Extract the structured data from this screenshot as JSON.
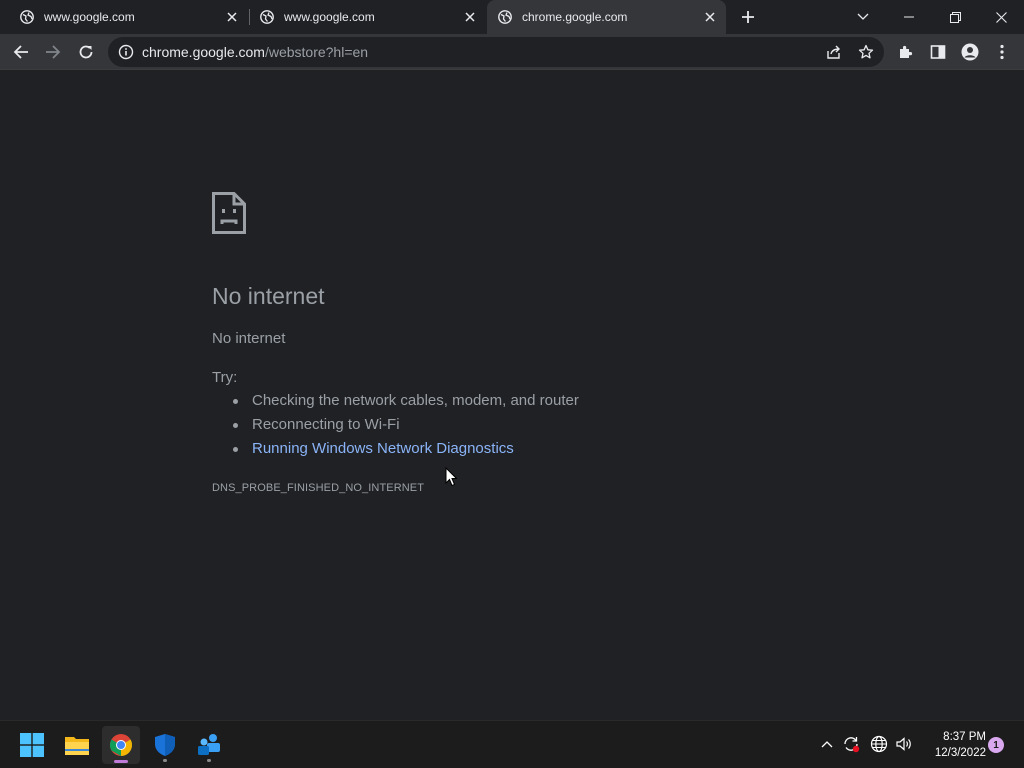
{
  "tabs": [
    {
      "title": "www.google.com",
      "active": false
    },
    {
      "title": "www.google.com",
      "active": false
    },
    {
      "title": "chrome.google.com",
      "active": true
    }
  ],
  "omnibox": {
    "url_host": "chrome.google.com",
    "url_path": "/webstore?hl=en"
  },
  "error_page": {
    "title": "No internet",
    "subtitle": "No internet",
    "try_label": "Try:",
    "suggestions": [
      {
        "text": "Checking the network cables, modem, and router",
        "is_link": false
      },
      {
        "text": "Reconnecting to Wi-Fi",
        "is_link": false
      },
      {
        "text": "Running Windows Network Diagnostics",
        "is_link": true
      }
    ],
    "error_code": "DNS_PROBE_FINISHED_NO_INTERNET"
  },
  "taskbar": {
    "apps": [
      "start-icon",
      "file-explorer-icon",
      "chrome-icon",
      "windows-security-icon",
      "teams-icon"
    ],
    "clock_time": "8:37 PM",
    "clock_date": "12/3/2022",
    "notification_count": "1"
  },
  "colors": {
    "background": "#202124",
    "toolbar": "#35363a",
    "text": "#9aa0a6",
    "link": "#8ab4f8",
    "taskbar": "#1c1c1c"
  }
}
